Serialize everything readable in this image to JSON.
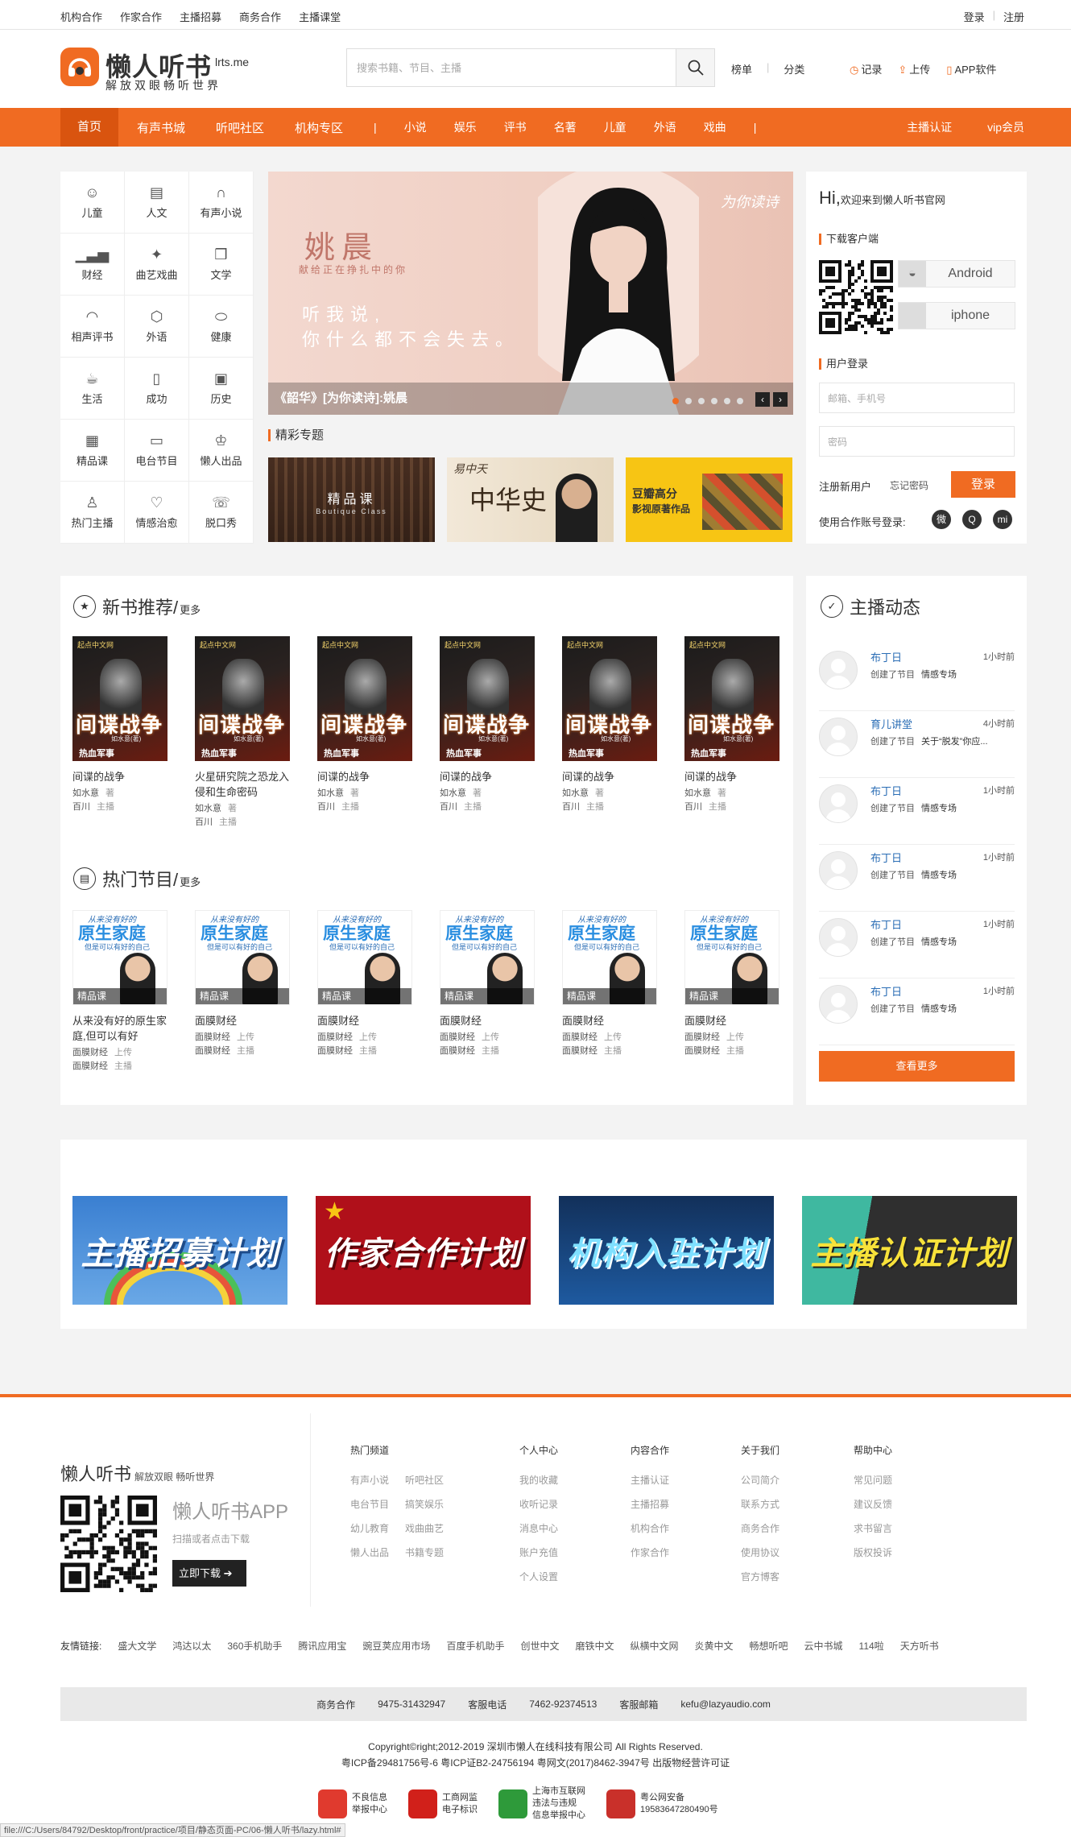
{
  "topbar": {
    "links": [
      "机构合作",
      "作家合作",
      "主播招募",
      "商务合作",
      "主播课堂"
    ],
    "login": "登录",
    "register": "注册"
  },
  "logo": {
    "name": "懒人听书",
    "domain": "lrts.me",
    "slogan": "解放双眼畅听世界"
  },
  "search": {
    "placeholder": "搜索书籍、节目、主播"
  },
  "header_nav": [
    "榜单",
    "分类"
  ],
  "header_tools": {
    "record": "记录",
    "upload": "上传",
    "app": "APP软件"
  },
  "nav": {
    "home": "首页",
    "items": [
      "有声书城",
      "听吧社区",
      "机构专区"
    ],
    "small_items": [
      "小说",
      "娱乐",
      "评书",
      "名著",
      "儿童",
      "外语",
      "戏曲"
    ],
    "right": [
      "主播认证",
      "vip会员"
    ]
  },
  "categories": [
    {
      "label": "儿童",
      "icon": "child-icon",
      "glyph": "☺"
    },
    {
      "label": "人文",
      "icon": "book-icon",
      "glyph": "▤"
    },
    {
      "label": "有声小说",
      "icon": "headphones-icon",
      "glyph": "∩"
    },
    {
      "label": "财经",
      "icon": "chart-icon",
      "glyph": "▁▃▅"
    },
    {
      "label": "曲艺戏曲",
      "icon": "fan-icon",
      "glyph": "✦"
    },
    {
      "label": "文学",
      "icon": "book-open-icon",
      "glyph": "❒"
    },
    {
      "label": "相声评书",
      "icon": "fan-open-icon",
      "glyph": "◠"
    },
    {
      "label": "外语",
      "icon": "cube-icon",
      "glyph": "⬡"
    },
    {
      "label": "健康",
      "icon": "pill-icon",
      "glyph": "⬭"
    },
    {
      "label": "生活",
      "icon": "teacup-icon",
      "glyph": "☕"
    },
    {
      "label": "成功",
      "icon": "trophy-icon",
      "glyph": "▯"
    },
    {
      "label": "历史",
      "icon": "scroll-icon",
      "glyph": "▣"
    },
    {
      "label": "精品课",
      "icon": "course-icon",
      "glyph": "▦"
    },
    {
      "label": "电台节目",
      "icon": "radio-icon",
      "glyph": "▭"
    },
    {
      "label": "懒人出品",
      "icon": "lazy-icon",
      "glyph": "♔"
    },
    {
      "label": "热门主播",
      "icon": "person-icon",
      "glyph": "♙"
    },
    {
      "label": "情感治愈",
      "icon": "heart-icon",
      "glyph": "♡"
    },
    {
      "label": "脱口秀",
      "icon": "mic-icon",
      "glyph": "☏"
    }
  ],
  "banner": {
    "name": "姚晨",
    "sub": "献给正在挣扎中的你",
    "line1": "听我说,",
    "line2": "你什么都不会失去。",
    "brand": "为你读诗",
    "caption": "《韶华》[为你读诗]:姚晨",
    "slides": 6,
    "active": 0
  },
  "special": {
    "title": "精彩专题",
    "items": [
      {
        "t": "精品课",
        "s": "Boutique Class"
      },
      {
        "t": "中华史",
        "s": "易中天"
      },
      {
        "t": "豆瓣高分",
        "s": "影视原著作品"
      }
    ]
  },
  "side": {
    "hi": "Hi,",
    "welcome": "欢迎来到懒人听书官网",
    "download_title": "下载客户端",
    "android": "Android",
    "iphone": "iphone",
    "login_title": "用户登录",
    "email_ph": "邮箱、手机号",
    "pwd_ph": "密码",
    "register": "注册新用户",
    "forgot": "忘记密码",
    "login_btn": "登录",
    "third_party": "使用合作账号登录:"
  },
  "new_books": {
    "title": "新书推荐/",
    "more": "更多",
    "items": [
      {
        "name": "间谍的战争",
        "author": "如水意",
        "author_role": "著",
        "host": "百川",
        "host_role": "主播"
      },
      {
        "name": "火星研究院之恐龙入侵和生命密码",
        "author": "如水意",
        "author_role": "著",
        "host": "百川",
        "host_role": "主播"
      },
      {
        "name": "间谍的战争",
        "author": "如水意",
        "author_role": "著",
        "host": "百川",
        "host_role": "主播"
      },
      {
        "name": "间谍的战争",
        "author": "如水意",
        "author_role": "著",
        "host": "百川",
        "host_role": "主播"
      },
      {
        "name": "间谍的战争",
        "author": "如水意",
        "author_role": "著",
        "host": "百川",
        "host_role": "主播"
      },
      {
        "name": "间谍的战争",
        "author": "如水意",
        "author_role": "著",
        "host": "百川",
        "host_role": "主播"
      }
    ],
    "cover": {
      "pub": "起点中文网",
      "title": "间谍战争",
      "author": "如水意(著)",
      "tag": "热血军事"
    }
  },
  "hot_programs": {
    "title": "热门节目/",
    "more": "更多",
    "items": [
      {
        "name": "从来没有好的原生家庭,但可以有好",
        "up": "面膜财经",
        "up_role": "上传",
        "host": "面膜财经",
        "host_role": "主播"
      },
      {
        "name": "面膜财经",
        "up": "面膜财经",
        "up_role": "上传",
        "host": "面膜财经",
        "host_role": "主播"
      },
      {
        "name": "面膜财经",
        "up": "面膜财经",
        "up_role": "上传",
        "host": "面膜财经",
        "host_role": "主播"
      },
      {
        "name": "面膜财经",
        "up": "面膜财经",
        "up_role": "上传",
        "host": "面膜财经",
        "host_role": "主播"
      },
      {
        "name": "面膜财经",
        "up": "面膜财经",
        "up_role": "上传",
        "host": "面膜财经",
        "host_role": "主播"
      },
      {
        "name": "面膜财经",
        "up": "面膜财经",
        "up_role": "上传",
        "host": "面膜财经",
        "host_role": "主播"
      }
    ],
    "cover": {
      "l1": "从来没有好的",
      "l2": "原生家庭",
      "l3": "但是可以有好的自己",
      "label": "精品课"
    }
  },
  "dynamics": {
    "title": "主播动态",
    "more": "查看更多",
    "items": [
      {
        "name": "布丁日",
        "time": "1小时前",
        "action": "创建了节目",
        "target": "情感专场"
      },
      {
        "name": "育儿讲堂",
        "time": "4小时前",
        "action": "创建了节目",
        "target": "关于“脱发”你应..."
      },
      {
        "name": "布丁日",
        "time": "1小时前",
        "action": "创建了节目",
        "target": "情感专场"
      },
      {
        "name": "布丁日",
        "time": "1小时前",
        "action": "创建了节目",
        "target": "情感专场"
      },
      {
        "name": "布丁日",
        "time": "1小时前",
        "action": "创建了节目",
        "target": "情感专场"
      },
      {
        "name": "布丁日",
        "time": "1小时前",
        "action": "创建了节目",
        "target": "情感专场"
      }
    ]
  },
  "plans": [
    "主播招募计划",
    "作家合作计划",
    "机构入驻计划",
    "主播认证计划"
  ],
  "footer": {
    "brand": "懒人听书",
    "brand_sub": "解放双眼 畅听世界",
    "app": "懒人听书APP",
    "scan": "扫描或者点击下载",
    "download": "立即下载",
    "cols": [
      {
        "h": "热门频道",
        "items": [
          "有声小说",
          "电台节目",
          "幼儿教育",
          "懒人出品"
        ]
      },
      {
        "h": "",
        "items": [
          "听吧社区",
          "搞笑娱乐",
          "戏曲曲艺",
          "书籍专题"
        ]
      },
      {
        "h": "个人中心",
        "items": [
          "我的收藏",
          "收听记录",
          "消息中心",
          "账户充值",
          "个人设置"
        ]
      },
      {
        "h": "内容合作",
        "items": [
          "主播认证",
          "主播招募",
          "机构合作",
          "作家合作"
        ]
      },
      {
        "h": "关于我们",
        "items": [
          "公司简介",
          "联系方式",
          "商务合作",
          "使用协议",
          "官方博客"
        ]
      },
      {
        "h": "帮助中心",
        "items": [
          "常见问题",
          "建议反馈",
          "求书留言",
          "版权投诉"
        ]
      }
    ],
    "friends_label": "友情链接:",
    "friends": [
      "盛大文学",
      "鸿达以太",
      "360手机助手",
      "腾讯应用宝",
      "豌豆荚应用市场",
      "百度手机助手",
      "创世中文",
      "磨铁中文",
      "纵横中文网",
      "炎黄中文",
      "畅想听吧",
      "云中书城",
      "114啦",
      "天方听书"
    ],
    "contact": {
      "biz_label": "商务合作",
      "biz": "9475-31432947",
      "svc_label": "客服电话",
      "svc": "7462-92374513",
      "mail_label": "客服邮箱",
      "mail": "kefu@lazyaudio.com"
    },
    "copy1": "Copyright©right;2012-2019 深圳市懒人在线科技有限公司 All Rights Reserved.",
    "copy2": "粤ICP备29481756号-6 粤ICP证B2-24756194 粤网文(2017)8462-3947号 出版物经营许可证",
    "badges": [
      {
        "t1": "不良信息",
        "t2": "举报中心",
        "color": "#e03a2e"
      },
      {
        "t1": "工商网监",
        "t2": "电子标识",
        "color": "#d1201a"
      },
      {
        "t1": "上海市互联网",
        "t2": "违法与违规",
        "t3": "信息举报中心",
        "color": "#2e9a3a"
      },
      {
        "t1": "粤公网安备",
        "t2": "19583647280490号",
        "color": "#c9302a"
      }
    ]
  },
  "status_bar": "file:///C:/Users/84792/Desktop/front/practice/项目/静态页面-PC/06-懒人听书/lazy.html#"
}
